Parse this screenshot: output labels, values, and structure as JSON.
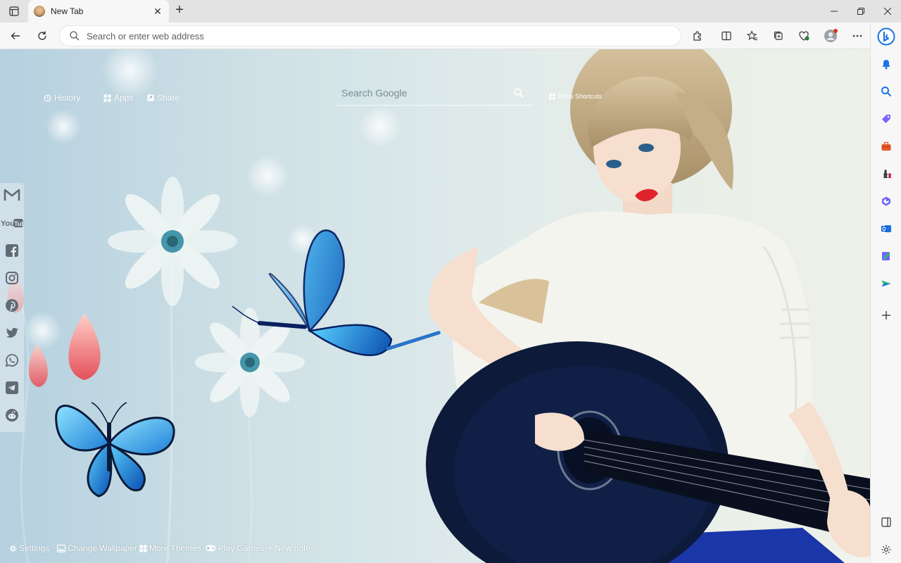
{
  "browser": {
    "tab": {
      "title": "New Tab"
    },
    "address_bar": {
      "placeholder": "Search or enter web address"
    }
  },
  "newtab": {
    "top_links": [
      {
        "label": "History"
      },
      {
        "label": "Apps"
      },
      {
        "label": "Share"
      }
    ],
    "search": {
      "placeholder": "Search Google"
    },
    "shortcuts_label": "Show Shortcuts",
    "social_icons": [
      "gmail-icon",
      "youtube-icon",
      "facebook-icon",
      "instagram-icon",
      "pinterest-icon",
      "twitter-icon",
      "whatsapp-icon",
      "telegram-icon",
      "reddit-icon"
    ],
    "bottom_links": [
      {
        "label": "Settings"
      },
      {
        "label": "Change Wallpaper"
      },
      {
        "label": "More Themes"
      },
      {
        "label": "Play Games"
      },
      {
        "label": "+ New note"
      }
    ]
  },
  "colors": {
    "bing_blue": "#1a73e8",
    "accent_red": "#d93025"
  }
}
